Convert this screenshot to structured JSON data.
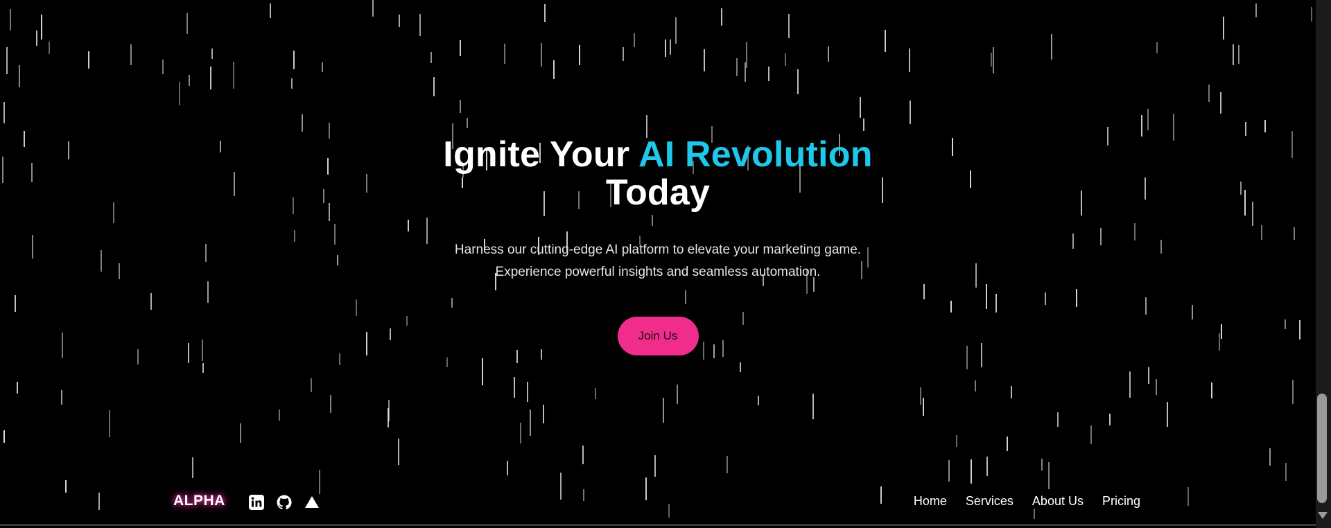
{
  "hero": {
    "title_part1": "Ignite Your ",
    "title_accent": "AI Revolution",
    "title_part2": "Today",
    "subtitle_line1": "Harness our cutting-edge AI platform to elevate your marketing game.",
    "subtitle_line2": "Experience powerful insights and seamless automation.",
    "cta_label": "Join Us"
  },
  "footer": {
    "logo": "ALPHA",
    "socials": [
      {
        "icon": "linkedin-icon"
      },
      {
        "icon": "github-icon"
      },
      {
        "icon": "triangle-icon"
      }
    ],
    "nav": [
      "Home",
      "Services",
      "About Us",
      "Pricing"
    ]
  },
  "colors": {
    "background": "#000000",
    "accent_text": "#1fc8ea",
    "cta_background": "#f02d8a",
    "logo_glow": "#ff3fb0"
  }
}
